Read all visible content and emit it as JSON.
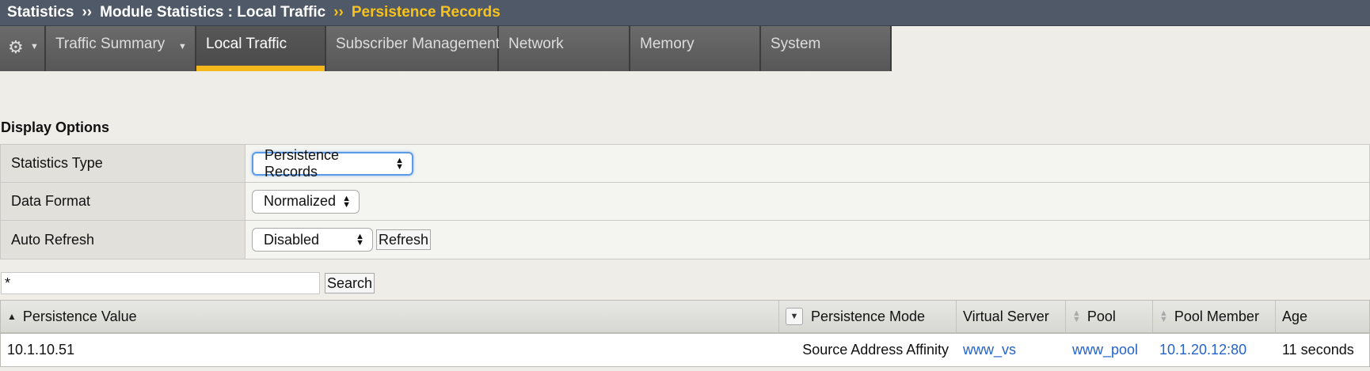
{
  "breadcrumb": {
    "items": [
      "Statistics",
      "Module Statistics : Local Traffic"
    ],
    "current": "Persistence Records",
    "separator": "››"
  },
  "tabs": [
    {
      "label": "Traffic Summary",
      "has_dropdown": true
    },
    {
      "label": "Local Traffic",
      "active": true
    },
    {
      "label": "Subscriber Management"
    },
    {
      "label": "Network"
    },
    {
      "label": "Memory"
    },
    {
      "label": "System"
    }
  ],
  "display_options": {
    "title": "Display Options",
    "statistics_type": {
      "label": "Statistics Type",
      "value": "Persistence Records"
    },
    "data_format": {
      "label": "Data Format",
      "value": "Normalized"
    },
    "auto_refresh": {
      "label": "Auto Refresh",
      "value": "Disabled",
      "refresh_button": "Refresh"
    }
  },
  "search": {
    "value": "*",
    "button": "Search"
  },
  "table": {
    "columns": [
      "Persistence Value",
      "Persistence Mode",
      "Virtual Server",
      "Pool",
      "Pool Member",
      "Age"
    ],
    "rows": [
      {
        "persistence_value": "10.1.10.51",
        "persistence_mode": "Source Address Affinity",
        "virtual_server": "www_vs",
        "pool": "www_pool",
        "pool_member": "10.1.20.12:80",
        "age": "11 seconds"
      }
    ]
  },
  "colors": {
    "accent": "#f4b81d",
    "breadcrumb_bg": "#505967",
    "link": "#2563c9"
  }
}
